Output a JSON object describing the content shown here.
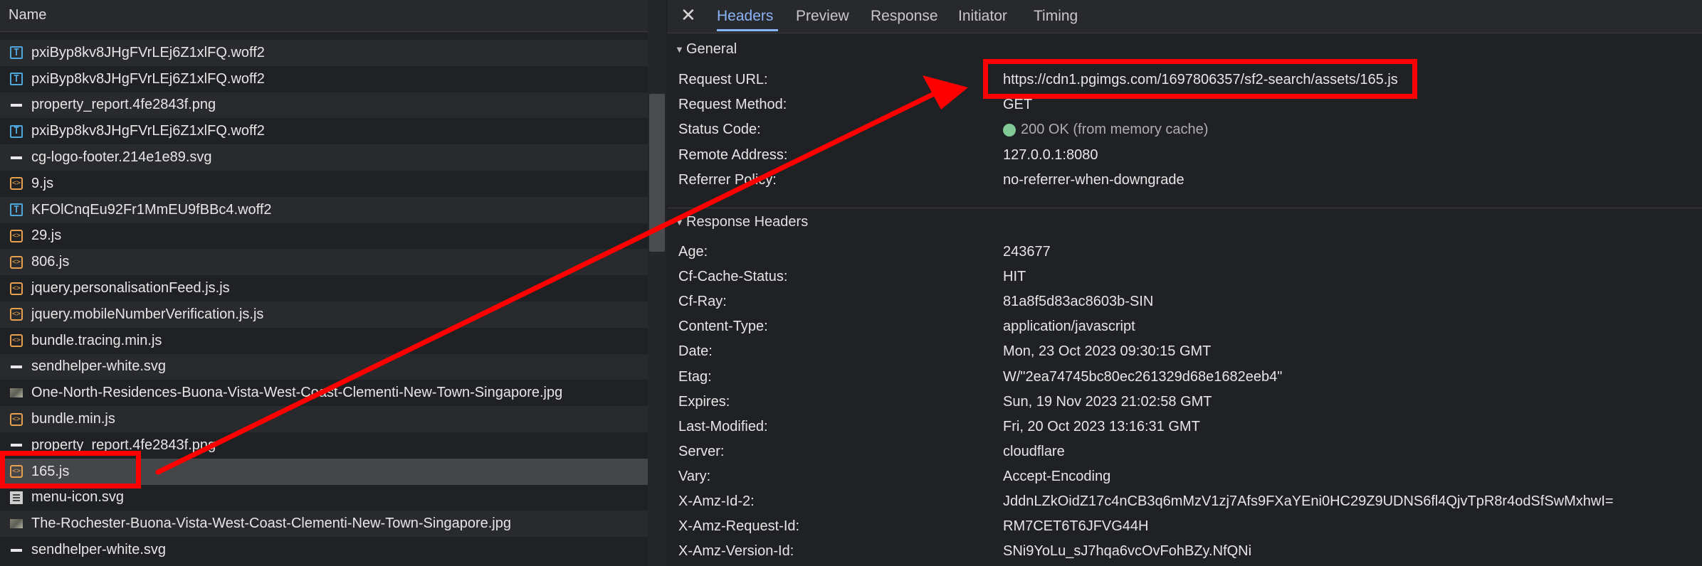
{
  "request_list": {
    "header": {
      "name_label": "Name",
      "sort_icon": "triangle-up-icon"
    },
    "rows": [
      {
        "name": "pxiByp8kv8JHgFVrLEj6Z1xlFQ.woff2",
        "icon": "font-file-icon"
      },
      {
        "name": "pxiByp8kv8JHgFVrLEj6Z1xlFQ.woff2",
        "icon": "font-file-icon"
      },
      {
        "name": "property_report.4fe2843f.png",
        "icon": "image-file-icon"
      },
      {
        "name": "pxiByp8kv8JHgFVrLEj6Z1xlFQ.woff2",
        "icon": "font-file-icon"
      },
      {
        "name": "cg-logo-footer.214e1e89.svg",
        "icon": "image-file-icon"
      },
      {
        "name": "9.js",
        "icon": "script-file-icon"
      },
      {
        "name": "KFOlCnqEu92Fr1MmEU9fBBc4.woff2",
        "icon": "font-file-icon"
      },
      {
        "name": "29.js",
        "icon": "script-file-icon"
      },
      {
        "name": "806.js",
        "icon": "script-file-icon"
      },
      {
        "name": "jquery.personalisationFeed.js.js",
        "icon": "script-file-icon"
      },
      {
        "name": "jquery.mobileNumberVerification.js.js",
        "icon": "script-file-icon"
      },
      {
        "name": "bundle.tracing.min.js",
        "icon": "script-file-icon"
      },
      {
        "name": "sendhelper-white.svg",
        "icon": "image-file-icon"
      },
      {
        "name": "One-North-Residences-Buona-Vista-West-Coast-Clementi-New-Town-Singapore.jpg",
        "icon": "photo-file-icon"
      },
      {
        "name": "bundle.min.js",
        "icon": "script-file-icon"
      },
      {
        "name": "property_report.4fe2843f.png",
        "icon": "image-file-icon"
      },
      {
        "name": "165.js",
        "icon": "script-file-icon",
        "selected": true
      },
      {
        "name": "menu-icon.svg",
        "icon": "menu-file-icon"
      },
      {
        "name": "The-Rochester-Buona-Vista-West-Coast-Clementi-New-Town-Singapore.jpg",
        "icon": "photo-file-icon"
      },
      {
        "name": "sendhelper-white.svg",
        "icon": "image-file-icon"
      }
    ]
  },
  "details": {
    "close_icon": "close-icon",
    "tabs": [
      {
        "label": "Headers",
        "active": true
      },
      {
        "label": "Preview"
      },
      {
        "label": "Response"
      },
      {
        "label": "Initiator"
      },
      {
        "label": "Timing"
      }
    ],
    "general": {
      "title": "General",
      "rows": [
        {
          "key": "Request URL:",
          "value": "https://cdn1.pgimgs.com/1697806357/sf2-search/assets/165.js"
        },
        {
          "key": "Request Method:",
          "value": "GET"
        },
        {
          "key": "Status Code:",
          "value": "200 OK (from memory cache)"
        },
        {
          "key": "Remote Address:",
          "value": "127.0.0.1:8080"
        },
        {
          "key": "Referrer Policy:",
          "value": "no-referrer-when-downgrade"
        }
      ]
    },
    "response_headers": {
      "title": "Response Headers",
      "rows": [
        {
          "key": "Age:",
          "value": "243677"
        },
        {
          "key": "Cf-Cache-Status:",
          "value": "HIT"
        },
        {
          "key": "Cf-Ray:",
          "value": "81a8f5d83ac8603b-SIN"
        },
        {
          "key": "Content-Type:",
          "value": "application/javascript"
        },
        {
          "key": "Date:",
          "value": "Mon, 23 Oct 2023 09:30:15 GMT"
        },
        {
          "key": "Etag:",
          "value": "W/\"2ea74745bc80ec261329d68e1682eeb4\""
        },
        {
          "key": "Expires:",
          "value": "Sun, 19 Nov 2023 21:02:58 GMT"
        },
        {
          "key": "Last-Modified:",
          "value": "Fri, 20 Oct 2023 13:16:31 GMT"
        },
        {
          "key": "Server:",
          "value": "cloudflare"
        },
        {
          "key": "Vary:",
          "value": "Accept-Encoding"
        },
        {
          "key": "X-Amz-Id-2:",
          "value": "JddnLZkOidZ17c4nCB3q6mMzV1zj7Afs9FXaYEni0HC29Z9UDNS6fl4QjvTpR8r4odSfSwMxhwI="
        },
        {
          "key": "X-Amz-Request-Id:",
          "value": "RM7CET6T6JFVG44H"
        },
        {
          "key": "X-Amz-Version-Id:",
          "value": "SNi9YoLu_sJ7hqa6vcOvFohBZy.NfQNi"
        }
      ]
    }
  },
  "annotation": {
    "color": "#ff0000"
  }
}
